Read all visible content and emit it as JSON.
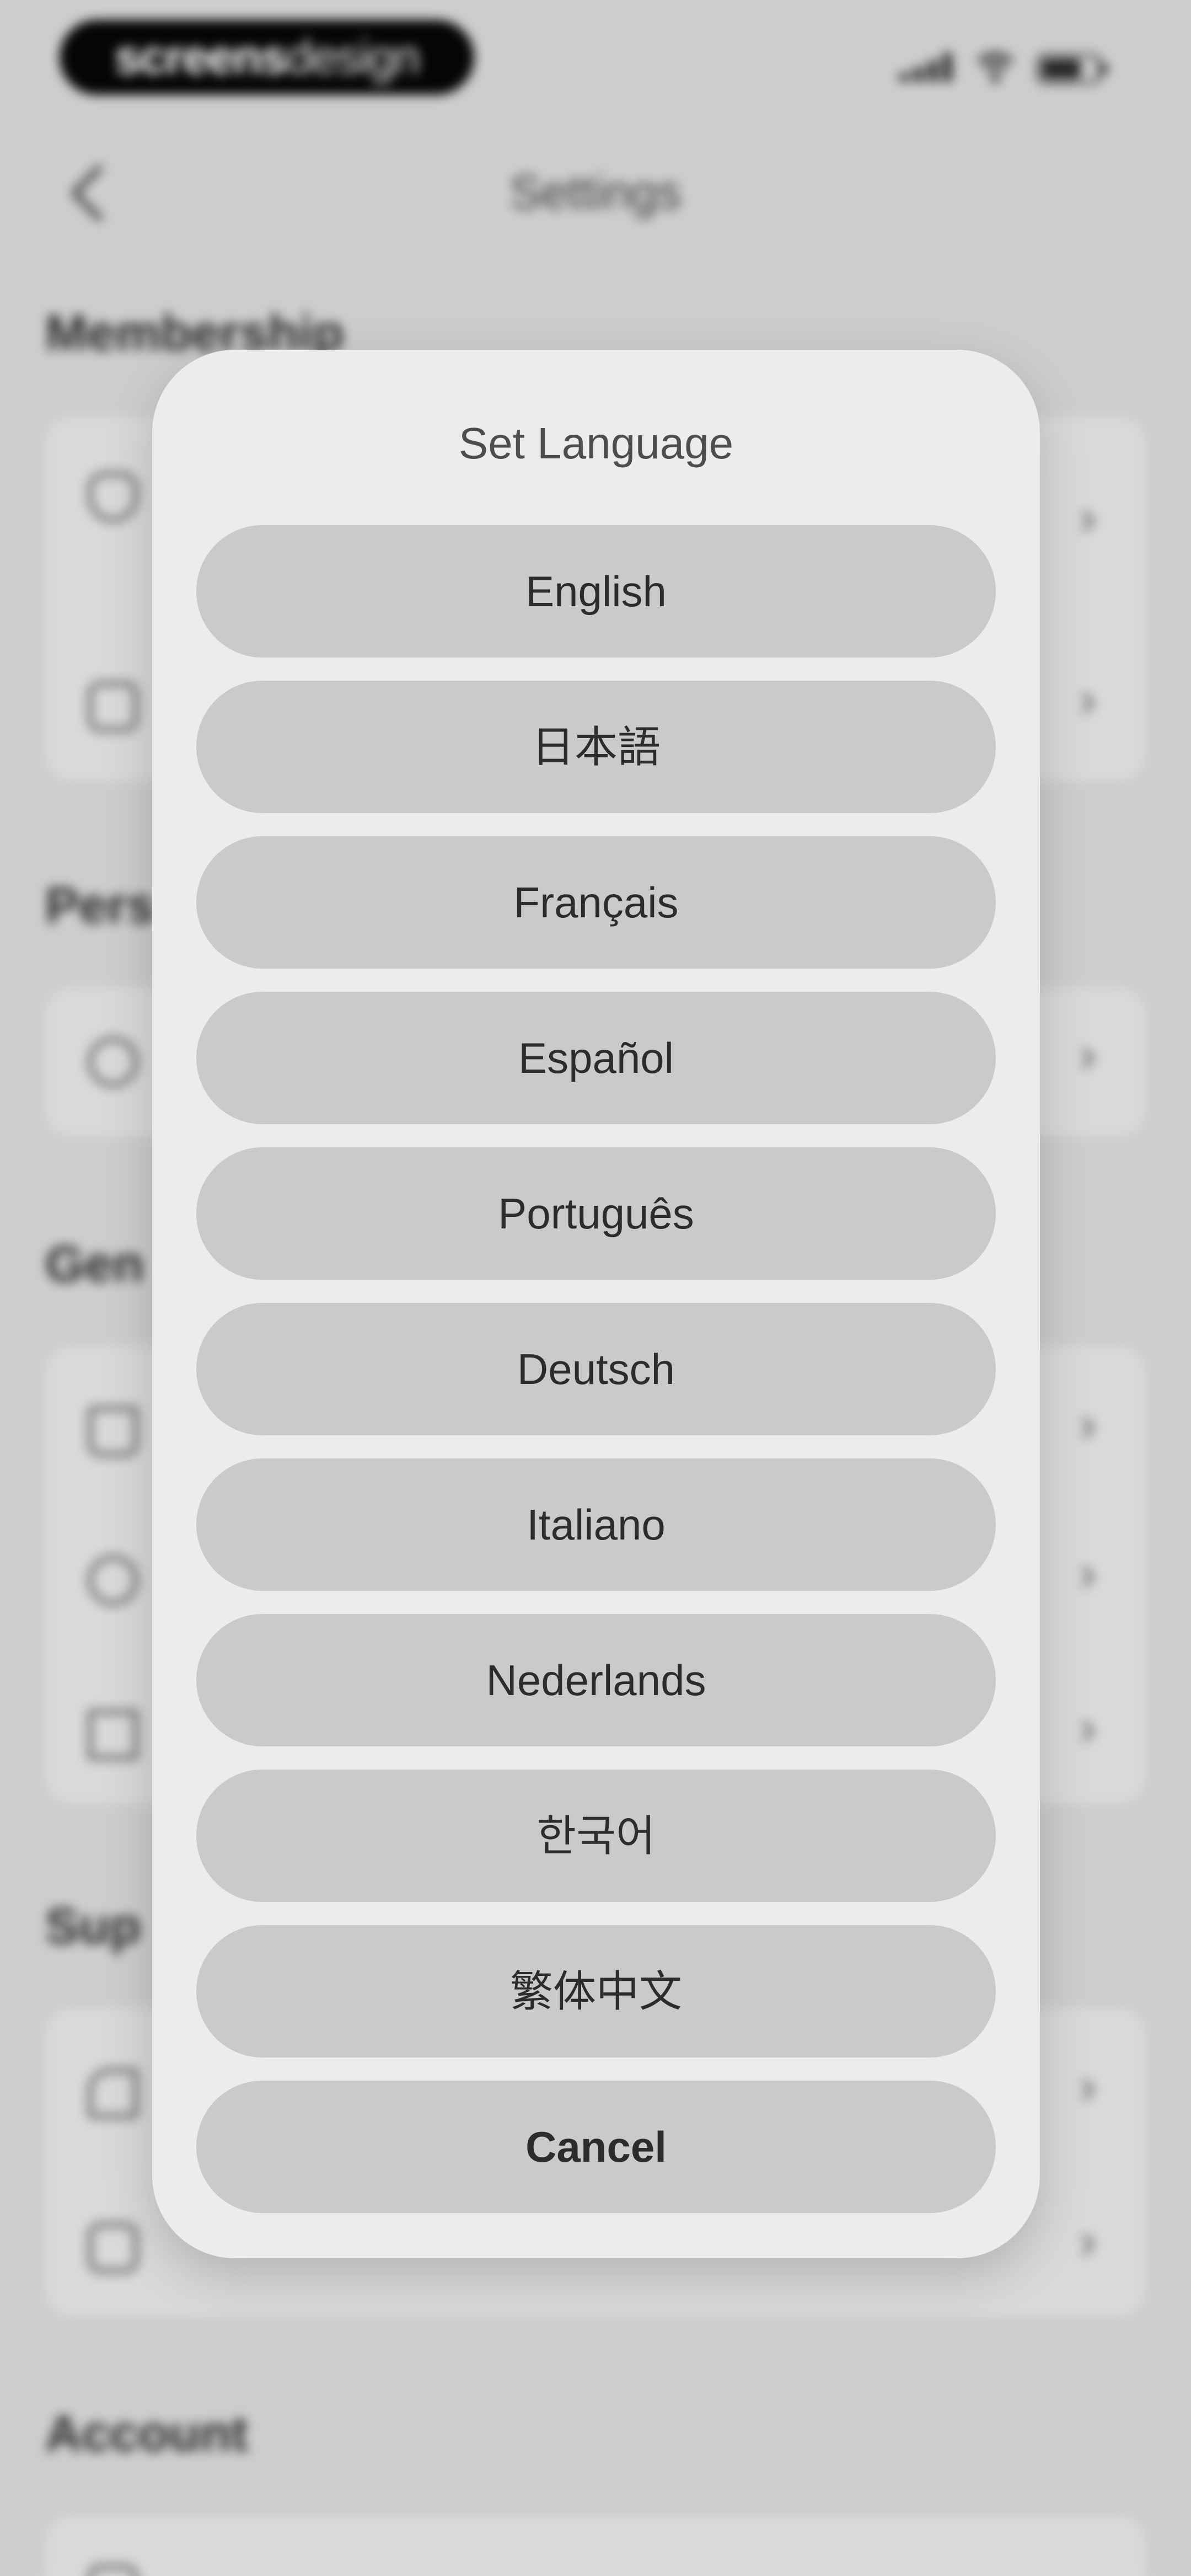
{
  "status_bar": {
    "brand_bold": "screens",
    "brand_light": "design",
    "icons": [
      "cellular-signal-icon",
      "wifi-icon",
      "battery-icon"
    ]
  },
  "header": {
    "back_icon": "chevron-left-icon",
    "title": "Settings"
  },
  "background_sections": [
    {
      "title": "Membership",
      "rows": [
        {
          "icon": "diamond-icon",
          "label": ""
        },
        {
          "icon": "download-icon",
          "label": ""
        }
      ]
    },
    {
      "title": "",
      "rows": [
        {
          "icon": "link-icon",
          "label": ""
        }
      ]
    },
    {
      "title": "",
      "rows": [
        {
          "icon": "home-icon",
          "label": ""
        },
        {
          "icon": "globe-icon",
          "label": ""
        },
        {
          "icon": "grid-icon",
          "label": ""
        }
      ]
    },
    {
      "title": "",
      "rows": [
        {
          "icon": "thumbs-up-icon",
          "label": ""
        },
        {
          "icon": "chat-icon",
          "label": ""
        }
      ]
    },
    {
      "title": "Account",
      "rows": []
    }
  ],
  "dialog": {
    "title": "Set Language",
    "options": [
      "English",
      "日本語",
      "Français",
      "Español",
      "Português",
      "Deutsch",
      "Italiano",
      "Nederlands",
      "한국어",
      "繁体中文"
    ],
    "cancel_label": "Cancel"
  },
  "colors": {
    "backdrop": "#cdcdcd",
    "dialog": "#ececec",
    "button": "#cacaca",
    "text": "#2c2c2c"
  }
}
